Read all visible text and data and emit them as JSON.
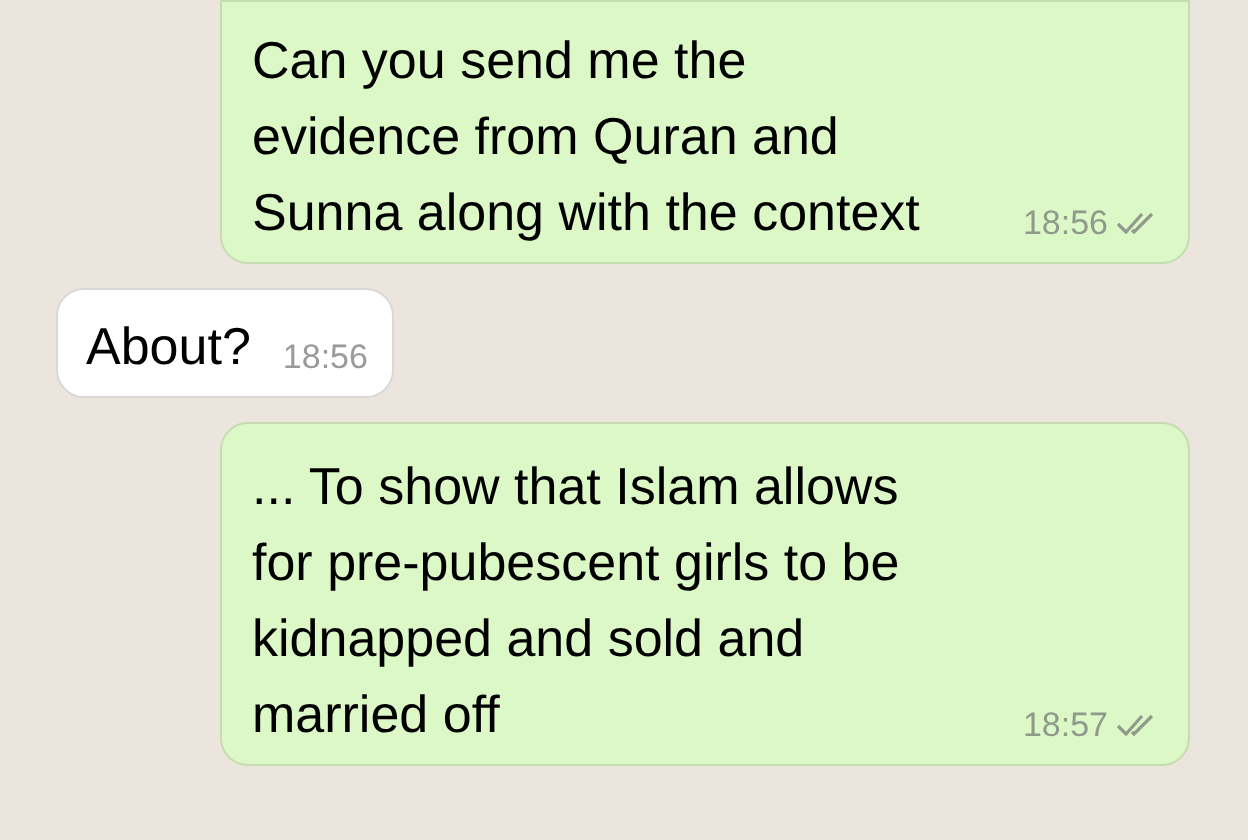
{
  "messages": [
    {
      "kind": "outgoing",
      "text": "Can you send me the evidence from Quran and Sunna along with the context",
      "time": "18:56",
      "read": true
    },
    {
      "kind": "incoming",
      "text": "About?",
      "time": "18:56"
    },
    {
      "kind": "outgoing",
      "text": "... To show that Islam allows for pre-pubescent girls to be kidnapped and sold and married off",
      "time": "18:57",
      "read": true
    }
  ]
}
